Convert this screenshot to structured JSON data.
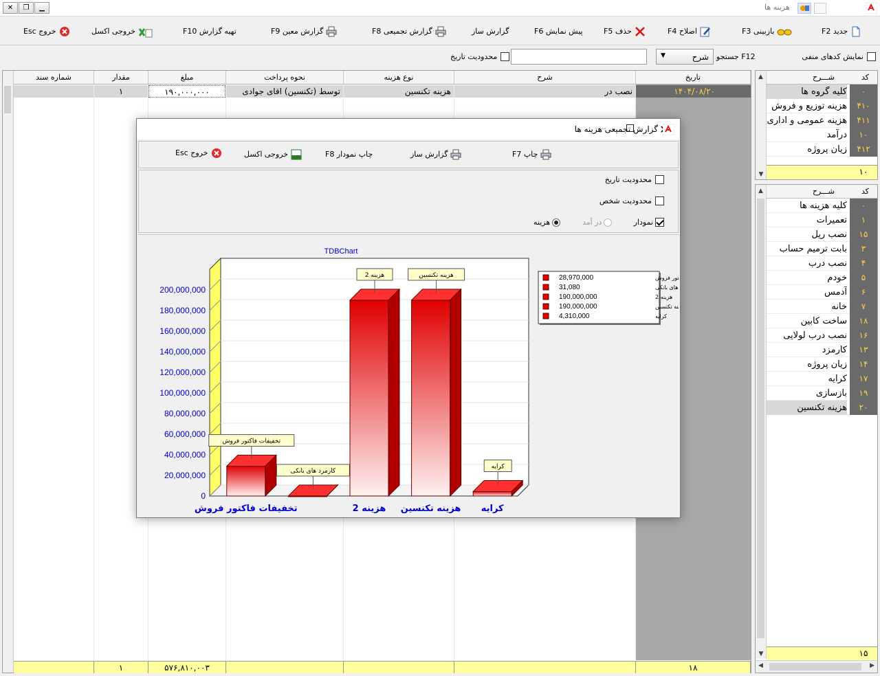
{
  "window": {
    "title": "هزینه ها"
  },
  "toolbar": [
    {
      "label": "جدید F2",
      "icon": "new-doc-icon"
    },
    {
      "label": "بازبینی F3",
      "icon": "glasses-icon"
    },
    {
      "label": "اصلاح F4",
      "icon": "edit-icon"
    },
    {
      "label": "حذف F5",
      "icon": "delete-icon"
    },
    {
      "label": "پیش نمایش F6",
      "icon": ""
    },
    {
      "label": "گزارش ساز",
      "icon": ""
    },
    {
      "label": "گزارش تجمیعی F8",
      "icon": "printer-icon"
    },
    {
      "label": "گزارش معین F9",
      "icon": "printer-icon"
    },
    {
      "label": "تهیه گزارش F10",
      "icon": ""
    },
    {
      "label": "خروجی اکسل",
      "icon": "excel-icon"
    },
    {
      "label": "خروج Esc",
      "icon": "exit-icon"
    }
  ],
  "filters": {
    "show_negative_label": "نمایش کدهای منفی",
    "search_label": "F12 جستجو",
    "search_field_value": "شرح",
    "search_value": "",
    "date_limit_label": "محدودیت تاریخ"
  },
  "grid": {
    "columns": [
      "تاریخ",
      "شرح",
      "نوع هزینه",
      "نحوه پرداخت",
      "مبلغ",
      "مقدار",
      "شماره سند"
    ],
    "row": {
      "date": "۱۴۰۴/۰۸/۲۰",
      "description": "نصب در",
      "cost_type": "هزینه تکنسین",
      "payment": "توسط (تکنسین) اقای جوادی",
      "amount": "۱۹۰,۰۰۰,۰۰۰",
      "qty": "۱",
      "doc_no": ""
    },
    "footer": {
      "count": "۱۸",
      "amount": "۵۷۶,۸۱۰,۰۰۳",
      "qty": "۱"
    }
  },
  "groups_panel": {
    "header_code": "کد",
    "header_desc": "شـــرح",
    "items": [
      {
        "code": "۰",
        "desc": "کلیه گروه ها"
      },
      {
        "code": "۴۱۰",
        "desc": "هزینه توزیع و فروش"
      },
      {
        "code": "۴۱۱",
        "desc": "هزینه عمومی و اداری"
      },
      {
        "code": "۱۰",
        "desc": "درآمد"
      },
      {
        "code": "۴۱۲",
        "desc": "زیان پروژه"
      }
    ],
    "footer_count": "۱۰"
  },
  "types_panel": {
    "header_code": "کد",
    "header_desc": "شـــرح",
    "items": [
      {
        "code": "۰",
        "desc": "کلیه هزینه ها"
      },
      {
        "code": "۱",
        "desc": "تعمیرات"
      },
      {
        "code": "۱۵",
        "desc": "نصب ریل"
      },
      {
        "code": "۳",
        "desc": "بابت ترمیم حساب"
      },
      {
        "code": "۴",
        "desc": "نصب درب"
      },
      {
        "code": "۵",
        "desc": "خودم"
      },
      {
        "code": "۶",
        "desc": "آدمس"
      },
      {
        "code": "۷",
        "desc": "خانه"
      },
      {
        "code": "۱۸",
        "desc": "ساخت کابین"
      },
      {
        "code": "۱۶",
        "desc": "نصب درب لولایی"
      },
      {
        "code": "۱۳",
        "desc": "کارمزد"
      },
      {
        "code": "۱۴",
        "desc": "زیان پروژه"
      },
      {
        "code": "۱۷",
        "desc": "کرایه"
      },
      {
        "code": "۱۹",
        "desc": "بازسازی"
      },
      {
        "code": "۲۰",
        "desc": "هزینه تکنسین"
      }
    ],
    "footer_count": "۱۵"
  },
  "dialog": {
    "title": "گزارش تجمیعی هزینه ها",
    "toolbar": {
      "print": "چاپ F7",
      "report_builder": "گزارش ساز",
      "print_chart": "چاپ نمودار F8",
      "excel": "خروجی اکسل",
      "exit": "خروج Esc"
    },
    "options": {
      "date_limit": "محدودیت تاریخ",
      "person_limit": "محدودیت شخص",
      "chart": "نمودار",
      "income": "در آمد",
      "expense": "هزینه"
    }
  },
  "chart_data": {
    "type": "bar",
    "title": "TDBChart",
    "categories": [
      "تخفیفات فاکتور فروش",
      "کارمزد های بانکی",
      "هزینه 2",
      "هزینه تکنسین",
      "کرایه"
    ],
    "axis_categories": [
      "تخفیفات فاکتور فروش",
      "",
      "هزینه 2",
      "هزینه تکنسین",
      "کرایه"
    ],
    "values": [
      28970000,
      31080,
      190000000,
      190000000,
      4310000
    ],
    "value_labels": [
      "28,970,000",
      "31,080",
      "190,000,000",
      "190,000,000",
      "4,310,000"
    ],
    "ylim": [
      0,
      200000000
    ],
    "yticks": [
      0,
      20000000,
      40000000,
      60000000,
      80000000,
      100000000,
      120000000,
      140000000,
      160000000,
      180000000,
      200000000
    ],
    "ytick_labels": [
      "0",
      "20,000,000",
      "40,000,000",
      "60,000,000",
      "80,000,000",
      "100,000,000",
      "120,000,000",
      "140,000,000",
      "160,000,000",
      "180,000,000",
      "200,000,000"
    ],
    "legend_position": "top-right",
    "colors": {
      "bar": "#e00000",
      "bar_light": "#fff0f0",
      "left_wall": "#ffff66",
      "axis_text": "#0000cc",
      "label_bg": "#ffffcc"
    },
    "grid": true
  }
}
